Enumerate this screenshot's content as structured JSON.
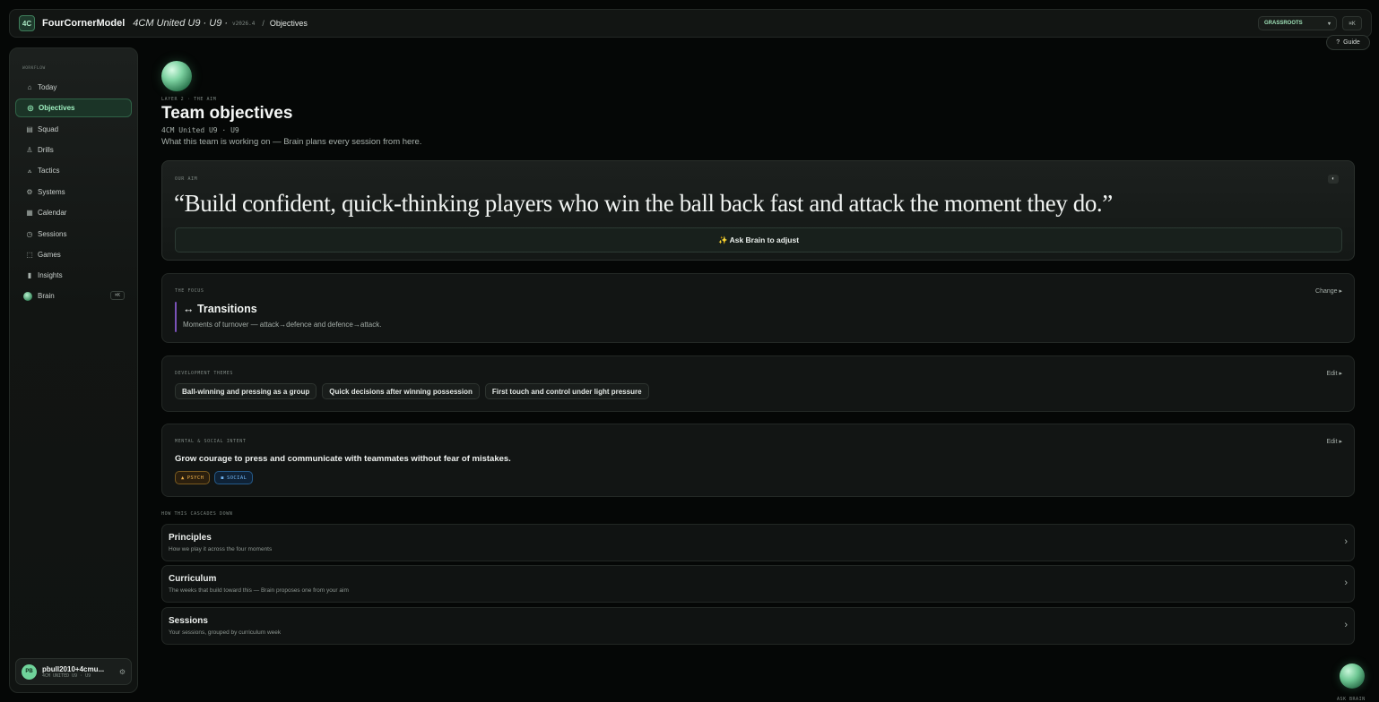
{
  "topbar": {
    "logo": "4C",
    "brand": "FourCornerModel",
    "team": "4CM United U9 · U9 ·",
    "version": "v2026.4",
    "separator": "/",
    "breadcrumb": "Objectives",
    "level": "GRASSROOTS",
    "chip": "⌘K"
  },
  "guide": {
    "icon": "?",
    "label": "Guide"
  },
  "sidebar": {
    "section": "WORKFLOW",
    "items": [
      {
        "label": "Today",
        "icon": "⌂"
      },
      {
        "label": "Objectives",
        "icon": "◎"
      },
      {
        "label": "Squad",
        "icon": "▤"
      },
      {
        "label": "Drills",
        "icon": "♙"
      },
      {
        "label": "Tactics",
        "icon": "⟑"
      },
      {
        "label": "Systems",
        "icon": "⚙"
      },
      {
        "label": "Calendar",
        "icon": "▦"
      },
      {
        "label": "Sessions",
        "icon": "◷"
      },
      {
        "label": "Games",
        "icon": "⬚"
      },
      {
        "label": "Insights",
        "icon": "▮"
      },
      {
        "label": "Brain",
        "chip": "⌘K"
      }
    ],
    "user": {
      "initials": "PB",
      "name": "pbull2010+4cmu...",
      "team": "4CM UNITED U9 · U9",
      "gear": "⚙"
    }
  },
  "page": {
    "layer_label": "LAYER 2 · THE AIM",
    "title": "Team objectives",
    "team": "4CM United U9 · U9",
    "subtitle": "What this team is working on — Brain plans every session from here."
  },
  "aim": {
    "label": "OUR AIM",
    "quote": "“Build confident, quick-thinking players who win the ball back fast and attack the moment they do.”",
    "icon": "◐",
    "ask_button": "✨ Ask Brain to adjust"
  },
  "focus": {
    "label": "THE FOCUS",
    "action": "Change ▸",
    "title": "↔ Transitions",
    "description": "Moments of turnover — attack→defence and defence→attack."
  },
  "themes": {
    "label": "DEVELOPMENT THEMES",
    "action": "Edit ▸",
    "chips": [
      "Ball-winning and pressing as a group",
      "Quick decisions after winning possession",
      "First touch and control under light pressure"
    ]
  },
  "mental": {
    "label": "MENTAL & SOCIAL INTENT",
    "action": "Edit ▸",
    "text": "Grow courage to press and communicate with teammates without fear of mistakes.",
    "tags": [
      {
        "icon": "▲",
        "label": "PSYCH",
        "color": "#f0b24a"
      },
      {
        "icon": "◼",
        "label": "SOCIAL",
        "color": "#6fb3f0"
      }
    ]
  },
  "cascade": {
    "label": "HOW THIS CASCADES DOWN",
    "rows": [
      {
        "title": "Principles",
        "desc": "How we play it across the four moments"
      },
      {
        "title": "Curriculum",
        "desc": "The weeks that build toward this — Brain proposes one from your aim"
      },
      {
        "title": "Sessions",
        "desc": "Your sessions, grouped by curriculum week"
      }
    ],
    "arrow": "›"
  },
  "fab": {
    "label": "ASK BRAIN"
  },
  "colors": {
    "accent": "#6fd39a",
    "background": "#050706",
    "focus_bar": "#7a52b8"
  }
}
